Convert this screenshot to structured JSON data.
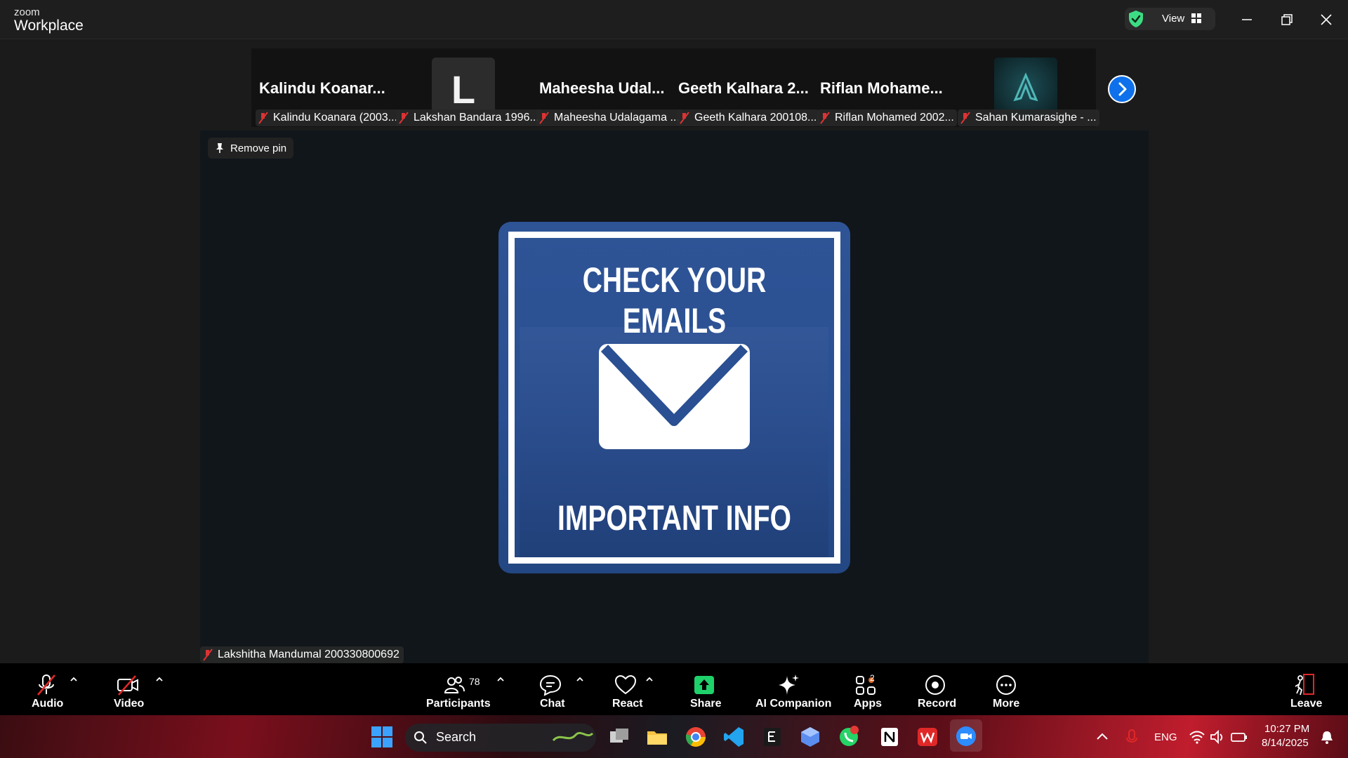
{
  "titlebar": {
    "brand_small": "zoom",
    "brand_big": "Workplace",
    "view_label": "View",
    "accent_shield": "#3ddc84"
  },
  "thumbnails": [
    {
      "name": "Kalindu  Koanar...",
      "caption": "Kalindu Koanara (2003..."
    },
    {
      "name": "",
      "avatar_letter": "L",
      "caption": "Lakshan Bandara 1996..."
    },
    {
      "name": "Maheesha  Udal...",
      "caption": "Maheesha Udalagama ..."
    },
    {
      "name": "Geeth  Kalhara  2...",
      "caption": "Geeth Kalhara 200108..."
    },
    {
      "name": "Riflan  Mohame...",
      "caption": "Riflan Mohamed 2002..."
    },
    {
      "name": "",
      "caption": "Sahan Kumarasighe - ..."
    }
  ],
  "main": {
    "remove_pin_label": "Remove pin",
    "card_top": "CHECK YOUR EMAILS",
    "card_bottom": "IMPORTANT INFO",
    "speaker": "Lakshitha Mandumal 200330800692"
  },
  "toolbar": {
    "audio": "Audio",
    "video": "Video",
    "participants": "Participants",
    "participants_count": "78",
    "chat": "Chat",
    "react": "React",
    "share": "Share",
    "ai_companion": "AI Companion",
    "apps": "Apps",
    "apps_badge": "2",
    "record": "Record",
    "more": "More",
    "leave": "Leave",
    "share_color": "#1fd16b",
    "leave_color": "#e02828"
  },
  "taskbar": {
    "search_placeholder": "Search",
    "language": "ENG",
    "time": "10:27 PM",
    "date": "8/14/2025"
  }
}
